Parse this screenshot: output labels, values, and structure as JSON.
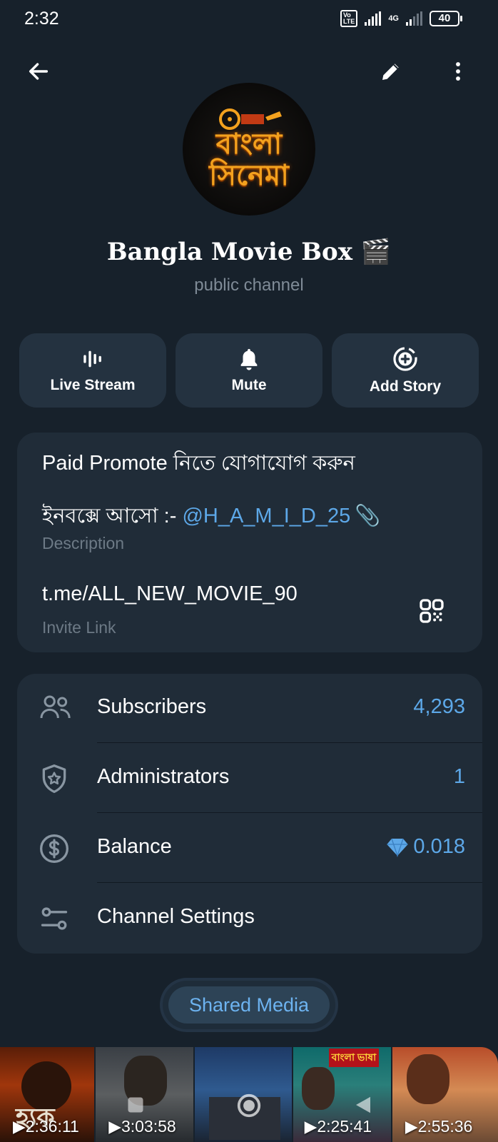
{
  "status_bar": {
    "time": "2:32",
    "volte": "Vo LTE",
    "network": "4G",
    "battery": "40"
  },
  "header": {
    "back_icon": "arrow-left-icon",
    "edit_icon": "pencil-icon",
    "more_icon": "more-vertical-icon"
  },
  "channel": {
    "avatar_line1": "বাংলা",
    "avatar_line2": "সিনেমা",
    "name": "Bangla Movie Box 🎬",
    "type": "public channel"
  },
  "actions": [
    {
      "label": "Live Stream",
      "icon": "live-stream-icon"
    },
    {
      "label": "Mute",
      "icon": "bell-icon"
    },
    {
      "label": "Add Story",
      "icon": "add-story-icon"
    }
  ],
  "info": {
    "description_line1": "Paid Promote নিতে যোগাযোগ করুন",
    "description_prefix": "ইনবক্সে আসো :- ",
    "description_mention": "@H_A_M_I_D_25",
    "description_emoji": "📎",
    "description_caption": "Description",
    "invite_link": "t.me/ALL_NEW_MOVIE_90",
    "invite_caption": "Invite Link",
    "qr_icon": "qr-code-icon"
  },
  "stats": [
    {
      "label": "Subscribers",
      "value": "4,293",
      "icon": "users-icon"
    },
    {
      "label": "Administrators",
      "value": "1",
      "icon": "shield-star-icon"
    },
    {
      "label": "Balance",
      "value": "0.018",
      "icon": "dollar-circle-icon",
      "value_icon": "diamond-icon"
    },
    {
      "label": "Channel Settings",
      "value": "",
      "icon": "settings-sliders-icon"
    }
  ],
  "shared_media": {
    "label": "Shared Media"
  },
  "media": [
    {
      "duration": "2:36:11",
      "overlay": "হ্যক"
    },
    {
      "duration": "3:03:58"
    },
    {
      "duration": ""
    },
    {
      "duration": "2:25:41",
      "overlay": "বাংলা ভাষা"
    },
    {
      "duration": "2:55:36"
    }
  ],
  "colors": {
    "background": "#17212b",
    "card": "#202c38",
    "accent": "#5da8e8",
    "muted": "#6d7a86"
  }
}
